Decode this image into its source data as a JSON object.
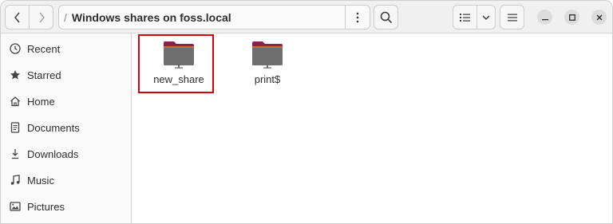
{
  "header": {
    "path_prefix": "/",
    "path_title": "Windows shares on foss.local"
  },
  "icons": {
    "back": "chevron-left-icon",
    "forward": "chevron-right-icon",
    "path_menu": "vertical-dots-icon",
    "search": "search-icon",
    "view": "list-view-icon",
    "view_dropdown": "chevron-down-icon",
    "main_menu": "hamburger-icon",
    "minimize": "minimize-icon",
    "maximize": "maximize-icon",
    "close": "close-icon",
    "folder": "network-folder-icon"
  },
  "sidebar": {
    "items": [
      {
        "label": "Recent",
        "icon": "clock-icon"
      },
      {
        "label": "Starred",
        "icon": "star-icon"
      },
      {
        "label": "Home",
        "icon": "home-icon"
      },
      {
        "label": "Documents",
        "icon": "document-icon"
      },
      {
        "label": "Downloads",
        "icon": "download-icon"
      },
      {
        "label": "Music",
        "icon": "music-icon"
      },
      {
        "label": "Pictures",
        "icon": "picture-icon"
      }
    ]
  },
  "files": [
    {
      "name": "new_share",
      "selected": true
    },
    {
      "name": "print$",
      "selected": false
    }
  ],
  "colors": {
    "highlight_box": "#d9000d",
    "folder_body": "#6e6e6e",
    "folder_tab": "#8d1f4f",
    "folder_top": "#d8643a"
  }
}
